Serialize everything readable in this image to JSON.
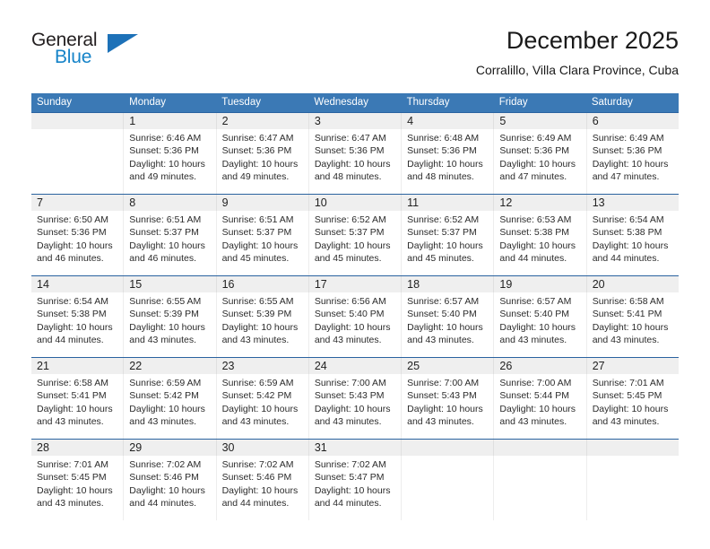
{
  "brand": {
    "name_part1": "General",
    "name_part2": "Blue",
    "triangle_icon": "triangle-icon",
    "color_dark": "#231f20",
    "color_blue": "#1583c8"
  },
  "header": {
    "title": "December 2025",
    "subtitle": "Corralillo, Villa Clara Province, Cuba"
  },
  "theme": {
    "header_blue": "#3b79b5",
    "week_divider_blue": "#2a63a0",
    "daynum_band": "#efefef"
  },
  "weekdays": [
    "Sunday",
    "Monday",
    "Tuesday",
    "Wednesday",
    "Thursday",
    "Friday",
    "Saturday"
  ],
  "weeks": [
    [
      {
        "day": "",
        "sunrise": "",
        "sunset": "",
        "daylight": ""
      },
      {
        "day": "1",
        "sunrise": "Sunrise: 6:46 AM",
        "sunset": "Sunset: 5:36 PM",
        "daylight": "Daylight: 10 hours and 49 minutes."
      },
      {
        "day": "2",
        "sunrise": "Sunrise: 6:47 AM",
        "sunset": "Sunset: 5:36 PM",
        "daylight": "Daylight: 10 hours and 49 minutes."
      },
      {
        "day": "3",
        "sunrise": "Sunrise: 6:47 AM",
        "sunset": "Sunset: 5:36 PM",
        "daylight": "Daylight: 10 hours and 48 minutes."
      },
      {
        "day": "4",
        "sunrise": "Sunrise: 6:48 AM",
        "sunset": "Sunset: 5:36 PM",
        "daylight": "Daylight: 10 hours and 48 minutes."
      },
      {
        "day": "5",
        "sunrise": "Sunrise: 6:49 AM",
        "sunset": "Sunset: 5:36 PM",
        "daylight": "Daylight: 10 hours and 47 minutes."
      },
      {
        "day": "6",
        "sunrise": "Sunrise: 6:49 AM",
        "sunset": "Sunset: 5:36 PM",
        "daylight": "Daylight: 10 hours and 47 minutes."
      }
    ],
    [
      {
        "day": "7",
        "sunrise": "Sunrise: 6:50 AM",
        "sunset": "Sunset: 5:36 PM",
        "daylight": "Daylight: 10 hours and 46 minutes."
      },
      {
        "day": "8",
        "sunrise": "Sunrise: 6:51 AM",
        "sunset": "Sunset: 5:37 PM",
        "daylight": "Daylight: 10 hours and 46 minutes."
      },
      {
        "day": "9",
        "sunrise": "Sunrise: 6:51 AM",
        "sunset": "Sunset: 5:37 PM",
        "daylight": "Daylight: 10 hours and 45 minutes."
      },
      {
        "day": "10",
        "sunrise": "Sunrise: 6:52 AM",
        "sunset": "Sunset: 5:37 PM",
        "daylight": "Daylight: 10 hours and 45 minutes."
      },
      {
        "day": "11",
        "sunrise": "Sunrise: 6:52 AM",
        "sunset": "Sunset: 5:37 PM",
        "daylight": "Daylight: 10 hours and 45 minutes."
      },
      {
        "day": "12",
        "sunrise": "Sunrise: 6:53 AM",
        "sunset": "Sunset: 5:38 PM",
        "daylight": "Daylight: 10 hours and 44 minutes."
      },
      {
        "day": "13",
        "sunrise": "Sunrise: 6:54 AM",
        "sunset": "Sunset: 5:38 PM",
        "daylight": "Daylight: 10 hours and 44 minutes."
      }
    ],
    [
      {
        "day": "14",
        "sunrise": "Sunrise: 6:54 AM",
        "sunset": "Sunset: 5:38 PM",
        "daylight": "Daylight: 10 hours and 44 minutes."
      },
      {
        "day": "15",
        "sunrise": "Sunrise: 6:55 AM",
        "sunset": "Sunset: 5:39 PM",
        "daylight": "Daylight: 10 hours and 43 minutes."
      },
      {
        "day": "16",
        "sunrise": "Sunrise: 6:55 AM",
        "sunset": "Sunset: 5:39 PM",
        "daylight": "Daylight: 10 hours and 43 minutes."
      },
      {
        "day": "17",
        "sunrise": "Sunrise: 6:56 AM",
        "sunset": "Sunset: 5:40 PM",
        "daylight": "Daylight: 10 hours and 43 minutes."
      },
      {
        "day": "18",
        "sunrise": "Sunrise: 6:57 AM",
        "sunset": "Sunset: 5:40 PM",
        "daylight": "Daylight: 10 hours and 43 minutes."
      },
      {
        "day": "19",
        "sunrise": "Sunrise: 6:57 AM",
        "sunset": "Sunset: 5:40 PM",
        "daylight": "Daylight: 10 hours and 43 minutes."
      },
      {
        "day": "20",
        "sunrise": "Sunrise: 6:58 AM",
        "sunset": "Sunset: 5:41 PM",
        "daylight": "Daylight: 10 hours and 43 minutes."
      }
    ],
    [
      {
        "day": "21",
        "sunrise": "Sunrise: 6:58 AM",
        "sunset": "Sunset: 5:41 PM",
        "daylight": "Daylight: 10 hours and 43 minutes."
      },
      {
        "day": "22",
        "sunrise": "Sunrise: 6:59 AM",
        "sunset": "Sunset: 5:42 PM",
        "daylight": "Daylight: 10 hours and 43 minutes."
      },
      {
        "day": "23",
        "sunrise": "Sunrise: 6:59 AM",
        "sunset": "Sunset: 5:42 PM",
        "daylight": "Daylight: 10 hours and 43 minutes."
      },
      {
        "day": "24",
        "sunrise": "Sunrise: 7:00 AM",
        "sunset": "Sunset: 5:43 PM",
        "daylight": "Daylight: 10 hours and 43 minutes."
      },
      {
        "day": "25",
        "sunrise": "Sunrise: 7:00 AM",
        "sunset": "Sunset: 5:43 PM",
        "daylight": "Daylight: 10 hours and 43 minutes."
      },
      {
        "day": "26",
        "sunrise": "Sunrise: 7:00 AM",
        "sunset": "Sunset: 5:44 PM",
        "daylight": "Daylight: 10 hours and 43 minutes."
      },
      {
        "day": "27",
        "sunrise": "Sunrise: 7:01 AM",
        "sunset": "Sunset: 5:45 PM",
        "daylight": "Daylight: 10 hours and 43 minutes."
      }
    ],
    [
      {
        "day": "28",
        "sunrise": "Sunrise: 7:01 AM",
        "sunset": "Sunset: 5:45 PM",
        "daylight": "Daylight: 10 hours and 43 minutes."
      },
      {
        "day": "29",
        "sunrise": "Sunrise: 7:02 AM",
        "sunset": "Sunset: 5:46 PM",
        "daylight": "Daylight: 10 hours and 44 minutes."
      },
      {
        "day": "30",
        "sunrise": "Sunrise: 7:02 AM",
        "sunset": "Sunset: 5:46 PM",
        "daylight": "Daylight: 10 hours and 44 minutes."
      },
      {
        "day": "31",
        "sunrise": "Sunrise: 7:02 AM",
        "sunset": "Sunset: 5:47 PM",
        "daylight": "Daylight: 10 hours and 44 minutes."
      },
      {
        "day": "",
        "sunrise": "",
        "sunset": "",
        "daylight": ""
      },
      {
        "day": "",
        "sunrise": "",
        "sunset": "",
        "daylight": ""
      },
      {
        "day": "",
        "sunrise": "",
        "sunset": "",
        "daylight": ""
      }
    ]
  ]
}
